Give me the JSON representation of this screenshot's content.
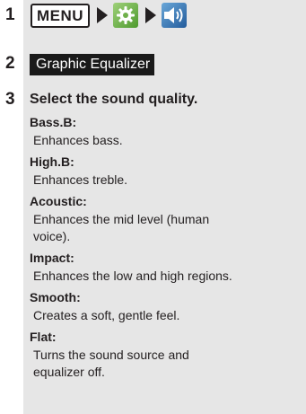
{
  "steps": {
    "step1": {
      "number": "1",
      "menu_button": "MENU",
      "settings_icon": "gear-icon",
      "sound_icon": "speaker-icon"
    },
    "step2": {
      "number": "2",
      "label": "Graphic Equalizer"
    },
    "step3": {
      "number": "3",
      "instruction": "Select the sound quality.",
      "options": [
        {
          "name": "Bass.B:",
          "desc": "Enhances bass."
        },
        {
          "name": "High.B:",
          "desc": "Enhances treble."
        },
        {
          "name": "Acoustic:",
          "desc": "Enhances the mid level (human voice)."
        },
        {
          "name": "Impact:",
          "desc": "Enhances the low and high regions."
        },
        {
          "name": "Smooth:",
          "desc": "Creates a soft, gentle feel."
        },
        {
          "name": "Flat:",
          "desc": "Turns the sound source and equalizer off."
        }
      ]
    }
  },
  "colors": {
    "panel": "#e6e6e6",
    "label_bg": "#1a1a1a",
    "text": "#231f20"
  }
}
